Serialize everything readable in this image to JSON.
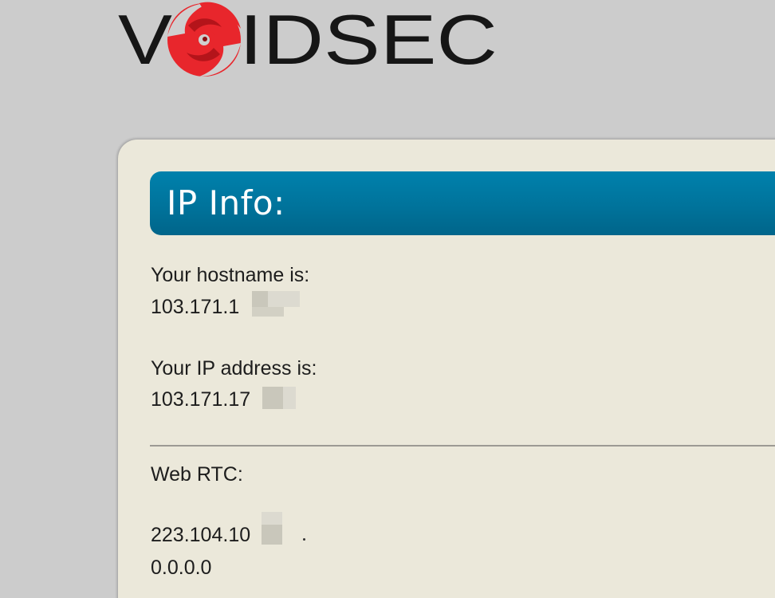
{
  "logo": {
    "text_left": "V",
    "text_right": "IDSEC",
    "full_text": "VOIDSEC",
    "icon": "red-swirl-icon",
    "colors": {
      "text": "#161616",
      "swirl": "#e8262c"
    }
  },
  "banner": {
    "title": "IP Info:",
    "color": "#00759e"
  },
  "hostname": {
    "label": "Your hostname is:",
    "value": "103.171.1"
  },
  "ip_address": {
    "label": "Your IP address is:",
    "value": "103.171.17"
  },
  "webrtc": {
    "label": "Web RTC:",
    "ips": [
      "223.104.10",
      "0.0.0.0"
    ]
  }
}
